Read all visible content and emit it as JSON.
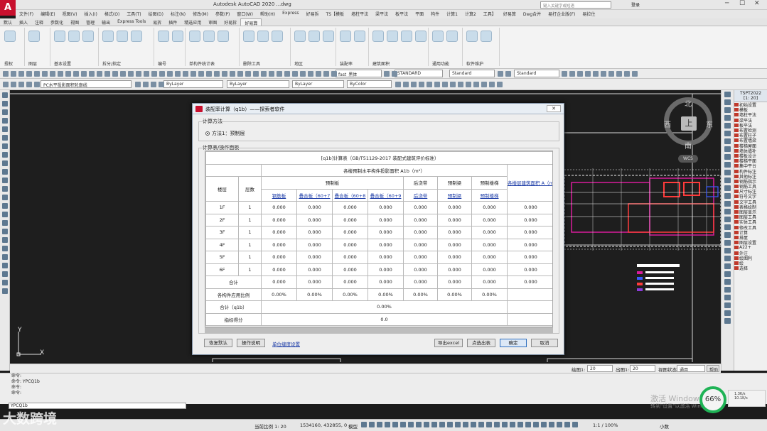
{
  "app": {
    "title": "Autodesk AutoCAD 2020  ...dwg",
    "search_placeholder": "键入关键字或短语",
    "login": "登录"
  },
  "menu": [
    "文件(F)",
    "编辑(E)",
    "视图(V)",
    "插入(I)",
    "格式(O)",
    "工具(T)",
    "绘图(D)",
    "标注(N)",
    "修改(M)",
    "参数(P)",
    "窗口(W)",
    "帮助(H)",
    "Express",
    "好易拆",
    "TS【模板",
    "墙柱平法",
    "梁平法",
    "板平法",
    "平面",
    "构件",
    "计算1",
    "计算2",
    "工具】",
    "好易算",
    "Dwg合并",
    "易打企业版(F)",
    "易拉住"
  ],
  "tabs": [
    "默认",
    "插入",
    "注释",
    "参数化",
    "视图",
    "管理",
    "输出",
    "Express Tools",
    "易拆",
    "插件",
    "精选应用",
    "审图",
    "好易拆",
    "好易算"
  ],
  "active_tab": "好易算",
  "ribbon_panels": [
    "授权",
    "图层",
    "基本设置",
    "拆分/指定",
    "编号",
    "单构件统计表",
    "删除工具",
    "地区",
    "装配率",
    "建筑面积",
    "通用功能",
    "软件维护"
  ],
  "toolbar": {
    "font_combo": "fast_黑体",
    "text_style": "STANDARD",
    "dim_style": "Standard",
    "table_style": "Standard",
    "layer_combo": "PC水平投影面积轮廓线",
    "color_combo": "ByLayer",
    "linetype_combo": "ByLayer",
    "lineweight_combo": "ByLayer",
    "plot_combo": "ByColor"
  },
  "compass": {
    "north": "北",
    "south": "南",
    "east": "东",
    "west": "西",
    "top": "上",
    "wcs": "WCS"
  },
  "ucs": {
    "x": "X",
    "y": "Y"
  },
  "viewbar": {
    "scale_label": "绘图1:",
    "scale_value": "20",
    "out_label": "出图1:",
    "out_value": "20",
    "state_label": "视图状态",
    "state_value": "通用",
    "help": "帮助"
  },
  "right_panel": {
    "title": "TSPT2022",
    "subtitle": "[1: 20]",
    "items": [
      "初始设置",
      "模板",
      "墙柱平法",
      "梁平法",
      "板平法",
      "布置检测",
      "布置柱子",
      "布置墙梁",
      "楼梯屋面",
      "墙体填补",
      "楼板设计",
      "楼梯平面",
      "集中平台",
      "构件标注",
      "其他标注",
      "钢筋指示",
      "钢筋工具",
      "尺寸标注",
      "符号文字",
      "文字工具",
      "表格绘制",
      "图层显示",
      "图层工具",
      "实体工具",
      "修改工具",
      "计算",
      "排屋",
      "图层设置",
      "A22+",
      "外注",
      "绘图利",
      "绘",
      "选择"
    ]
  },
  "dialog": {
    "title": "装配率计算（q1b）——探索者软件",
    "close": "关闭",
    "method_group": "计算方法",
    "method_option": "方法1：预制层",
    "table_group": "计算表/操作面板",
    "table_title": "[q1b]计算表（GB/T51129-2017 装配式建筑评价标准）",
    "header": {
      "floor": "楼层",
      "layers": "层数",
      "area_group": "各楼预制水平构件投影面积 A1b（m²）",
      "precast_board": "预制板",
      "post_pour": "后浇带",
      "precast_beam": "预制梁",
      "precast_stair": "预制楼梯",
      "total_area": "各楼层建筑面积 A（m²）"
    },
    "subheader": [
      "钢筋板",
      "叠合板（60+7",
      "叠合板（60+8",
      "叠合板（60+9",
      "后浇带",
      "预制梁",
      "预制楼梯"
    ],
    "rows": [
      {
        "floor": "1F",
        "layers": "1",
        "values": [
          "0.000",
          "0.000",
          "0.000",
          "0.000",
          "0.000",
          "0.000",
          "0.000",
          "0.000"
        ]
      },
      {
        "floor": "2F",
        "layers": "1",
        "values": [
          "0.000",
          "0.000",
          "0.000",
          "0.000",
          "0.000",
          "0.000",
          "0.000",
          "0.000"
        ]
      },
      {
        "floor": "3F",
        "layers": "1",
        "values": [
          "0.000",
          "0.000",
          "0.000",
          "0.000",
          "0.000",
          "0.000",
          "0.000",
          "0.000"
        ]
      },
      {
        "floor": "4F",
        "layers": "1",
        "values": [
          "0.000",
          "0.000",
          "0.000",
          "0.000",
          "0.000",
          "0.000",
          "0.000",
          "0.000"
        ]
      },
      {
        "floor": "5F",
        "layers": "1",
        "values": [
          "0.000",
          "0.000",
          "0.000",
          "0.000",
          "0.000",
          "0.000",
          "0.000",
          "0.000"
        ]
      },
      {
        "floor": "6F",
        "layers": "1",
        "values": [
          "0.000",
          "0.000",
          "0.000",
          "0.000",
          "0.000",
          "0.000",
          "0.000",
          "0.000"
        ]
      }
    ],
    "sum_label": "合计",
    "sum_values": [
      "0.000",
      "0.000",
      "0.000",
      "0.000",
      "0.000",
      "0.000",
      "0.000",
      "0.000"
    ],
    "ratio_label": "各构件应用比例",
    "ratio_values": [
      "0.00%",
      "0.00%",
      "0.00%",
      "0.00%",
      "0.00%",
      "0.00%",
      "0.00%"
    ],
    "total_label": "合计（q1b）",
    "total_value": "0.00%",
    "score_label": "指标得分",
    "score_value": "0.0",
    "buttons": {
      "restore": "恢复默认",
      "help": "操作说明",
      "unit_link": "单位缝度设置",
      "export": "导出excel",
      "select_output": "点选出表",
      "ok": "确定",
      "cancel": "取消"
    }
  },
  "command": {
    "lines": [
      "命令:",
      "命令: YPCQ1b",
      "命令:",
      "命令:"
    ],
    "input_prompt": "YPCQ1b"
  },
  "status": {
    "scale": "当前比例 1: 20",
    "coords": "1534160, 432855, 0",
    "model": "模型",
    "zoom": "1:1 / 100%",
    "units": "小数"
  },
  "overlay": {
    "watermark": "大数跨境",
    "activate": "激活 Windows",
    "activate_sub": "转到\"设置\"以激活 Windows。",
    "gauge": "66%",
    "net_up": "1.3K/s",
    "net_down": "10.1K/s"
  }
}
